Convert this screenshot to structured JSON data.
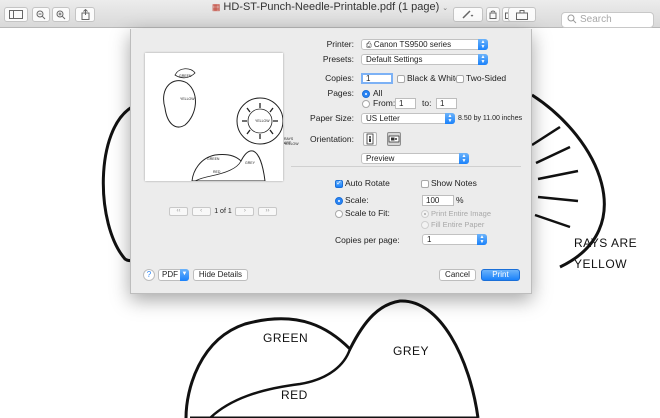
{
  "window": {
    "title": "HD-ST-Punch-Needle-Printable.pdf (1 page)",
    "search_placeholder": "Search"
  },
  "document": {
    "labels": {
      "rays_are": "RAYS ARE",
      "yellow": "YELLOW",
      "green": "GREEN",
      "grey": "GREY",
      "red": "RED"
    }
  },
  "print_dialog": {
    "printer": {
      "label": "Printer:",
      "value": "Canon TS9500 series"
    },
    "presets": {
      "label": "Presets:",
      "value": "Default Settings"
    },
    "copies": {
      "label": "Copies:",
      "value": "1"
    },
    "black_white": {
      "label": "Black & White",
      "checked": false
    },
    "two_sided": {
      "label": "Two-Sided",
      "checked": false
    },
    "pages": {
      "label": "Pages:",
      "all_label": "All",
      "from_label": "From:",
      "from_value": "1",
      "to_label": "to:",
      "to_value": "1",
      "selected": "All"
    },
    "paper_size": {
      "label": "Paper Size:",
      "value": "US Letter",
      "dimensions": "8.50 by 11.00 inches"
    },
    "orientation": {
      "label": "Orientation:",
      "selected": "landscape"
    },
    "section_menu": {
      "value": "Preview"
    },
    "auto_rotate": {
      "label": "Auto Rotate",
      "checked": true
    },
    "show_notes": {
      "label": "Show Notes",
      "checked": false
    },
    "scale": {
      "label": "Scale:",
      "value": "100",
      "selected": true
    },
    "scale_to_fit": {
      "label": "Scale to Fit:",
      "print_entire_image": "Print Entire Image",
      "fill_entire_paper": "Fill Entire Paper"
    },
    "copies_per_page": {
      "label": "Copies per page:",
      "value": "1"
    },
    "preview_pager": {
      "first": "‹‹",
      "prev": "‹",
      "page_label": "1 of 1",
      "next": "›",
      "last": "››"
    },
    "preview_labels": {
      "sun_label": "YELLOW",
      "lemon_label": "YELLOW",
      "lemon_leaf": "GREEN",
      "rays_are": "RAYS ARE",
      "rays_yellow": "YELLOW",
      "hill_green": "GREEN",
      "hill_grey": "GREY",
      "hill_red": "RED"
    },
    "buttons": {
      "help": "?",
      "pdf": "PDF",
      "hide_details": "Hide Details",
      "cancel": "Cancel",
      "print": "Print"
    },
    "accent": "#1a82fb"
  }
}
